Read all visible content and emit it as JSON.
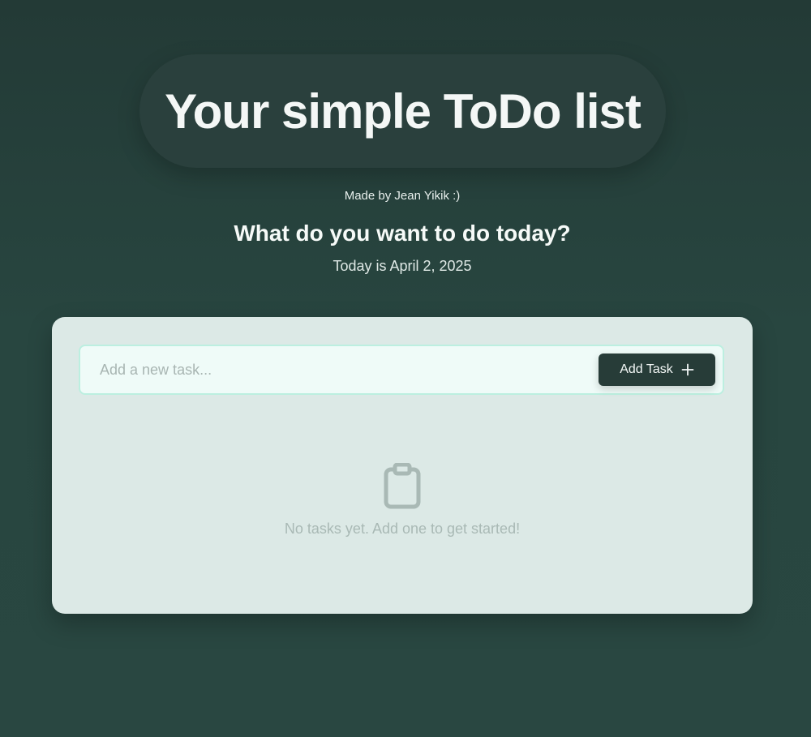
{
  "header": {
    "title": "Your simple ToDo list",
    "credit": "Made by Jean Yikik :)",
    "question": "What do you want to do today?",
    "date_text": "Today is April 2, 2025"
  },
  "task_form": {
    "input_value": "",
    "placeholder": "Add a new task...",
    "add_button_label": "Add Task",
    "add_button_icon": "plus-icon"
  },
  "task_list": {
    "items": [],
    "empty_icon": "clipboard-icon",
    "empty_message": "No tasks yet. Add one to get started!"
  },
  "colors": {
    "background": "#284640",
    "title_pill": "#2a403d",
    "card": "#dce9e6",
    "input_background": "#effbf8",
    "input_border": "#bcefe0",
    "button": "#273c38",
    "muted_text": "#a9b9b5"
  }
}
